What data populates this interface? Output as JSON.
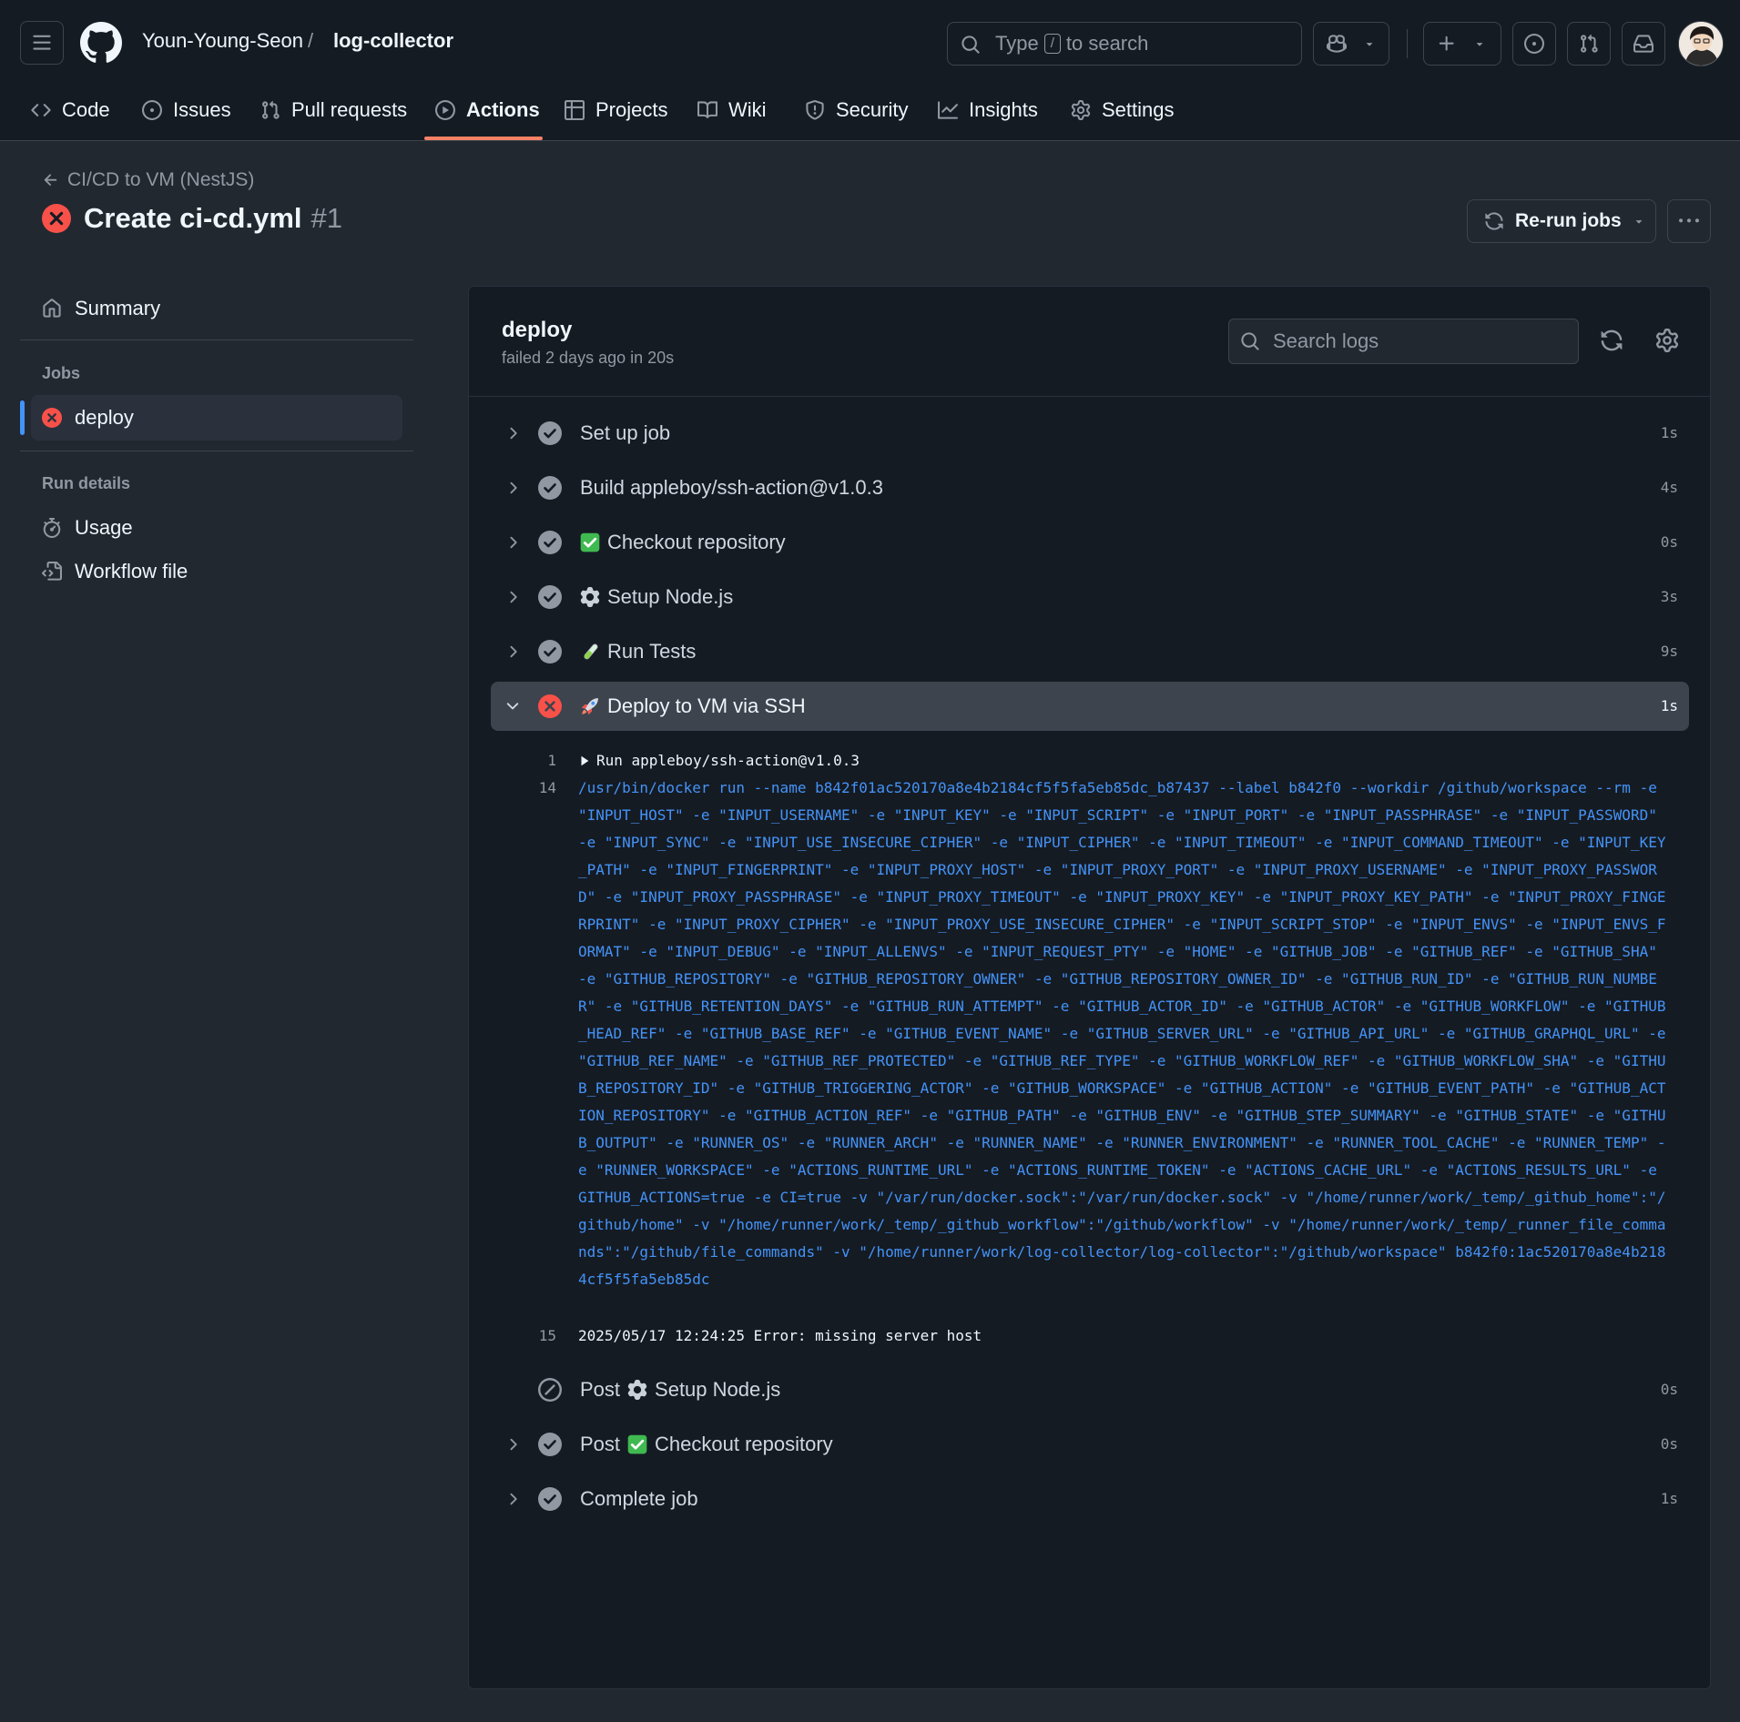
{
  "header": {
    "owner": "Youn-Young-Seon",
    "separator": "/",
    "repo": "log-collector",
    "search_prefix": "Type",
    "search_key": "/",
    "search_suffix": "to search"
  },
  "tabs": [
    {
      "label": "Code",
      "icon": "code-icon"
    },
    {
      "label": "Issues",
      "icon": "issue-icon"
    },
    {
      "label": "Pull requests",
      "icon": "pull-request-icon"
    },
    {
      "label": "Actions",
      "icon": "play-icon",
      "active": true
    },
    {
      "label": "Projects",
      "icon": "table-icon"
    },
    {
      "label": "Wiki",
      "icon": "book-icon"
    },
    {
      "label": "Security",
      "icon": "shield-icon"
    },
    {
      "label": "Insights",
      "icon": "graph-icon"
    },
    {
      "label": "Settings",
      "icon": "gear-icon"
    }
  ],
  "run": {
    "workflow_link": "CI/CD to VM (NestJS)",
    "title": "Create ci-cd.yml",
    "number": "#1",
    "rerun_label": "Re-run jobs"
  },
  "sidebar": {
    "summary": "Summary",
    "jobs_heading": "Jobs",
    "job": "deploy",
    "run_details_heading": "Run details",
    "usage": "Usage",
    "workflow_file": "Workflow file"
  },
  "job": {
    "name": "deploy",
    "status": "failed 2 days ago in 20s",
    "search_placeholder": "Search logs"
  },
  "steps": [
    {
      "prefix": "",
      "emoji": "",
      "label": "Set up job",
      "duration": "1s",
      "status": "success"
    },
    {
      "prefix": "",
      "emoji": "",
      "label": "Build appleboy/ssh-action@v1.0.3",
      "duration": "4s",
      "status": "success"
    },
    {
      "prefix": "",
      "emoji": "check-mark-emoji",
      "label": "Checkout repository",
      "duration": "0s",
      "status": "success"
    },
    {
      "prefix": "",
      "emoji": "gear-emoji",
      "label": "Setup Node.js",
      "duration": "3s",
      "status": "success"
    },
    {
      "prefix": "",
      "emoji": "test-tube-emoji",
      "label": "Run Tests",
      "duration": "9s",
      "status": "success"
    },
    {
      "prefix": "",
      "emoji": "rocket-emoji",
      "label": "Deploy to VM via SSH",
      "duration": "1s",
      "status": "failure",
      "expanded": true
    },
    {
      "prefix": "Post",
      "emoji": "gear-emoji",
      "label": "Setup Node.js",
      "duration": "0s",
      "status": "skipped"
    },
    {
      "prefix": "Post",
      "emoji": "check-mark-emoji",
      "label": "Checkout repository",
      "duration": "0s",
      "status": "success"
    },
    {
      "prefix": "",
      "emoji": "",
      "label": "Complete job",
      "duration": "1s",
      "status": "success"
    }
  ],
  "log": {
    "line1_num": "1",
    "line1_text": "Run appleboy/ssh-action@v1.0.3",
    "line14_num": "14",
    "line14_text": "/usr/bin/docker run --name b842f01ac520170a8e4b2184cf5f5fa5eb85dc_b87437 --label b842f0 --workdir /github/workspace --rm -e \"INPUT_HOST\" -e \"INPUT_USERNAME\" -e \"INPUT_KEY\" -e \"INPUT_SCRIPT\" -e \"INPUT_PORT\" -e \"INPUT_PASSPHRASE\" -e \"INPUT_PASSWORD\" -e \"INPUT_SYNC\" -e \"INPUT_USE_INSECURE_CIPHER\" -e \"INPUT_CIPHER\" -e \"INPUT_TIMEOUT\" -e \"INPUT_COMMAND_TIMEOUT\" -e \"INPUT_KEY_PATH\" -e \"INPUT_FINGERPRINT\" -e \"INPUT_PROXY_HOST\" -e \"INPUT_PROXY_PORT\" -e \"INPUT_PROXY_USERNAME\" -e \"INPUT_PROXY_PASSWORD\" -e \"INPUT_PROXY_PASSPHRASE\" -e \"INPUT_PROXY_TIMEOUT\" -e \"INPUT_PROXY_KEY\" -e \"INPUT_PROXY_KEY_PATH\" -e \"INPUT_PROXY_FINGERPRINT\" -e \"INPUT_PROXY_CIPHER\" -e \"INPUT_PROXY_USE_INSECURE_CIPHER\" -e \"INPUT_SCRIPT_STOP\" -e \"INPUT_ENVS\" -e \"INPUT_ENVS_FORMAT\" -e \"INPUT_DEBUG\" -e \"INPUT_ALLENVS\" -e \"INPUT_REQUEST_PTY\" -e \"HOME\" -e \"GITHUB_JOB\" -e \"GITHUB_REF\" -e \"GITHUB_SHA\" -e \"GITHUB_REPOSITORY\" -e \"GITHUB_REPOSITORY_OWNER\" -e \"GITHUB_REPOSITORY_OWNER_ID\" -e \"GITHUB_RUN_ID\" -e \"GITHUB_RUN_NUMBER\" -e \"GITHUB_RETENTION_DAYS\" -e \"GITHUB_RUN_ATTEMPT\" -e \"GITHUB_ACTOR_ID\" -e \"GITHUB_ACTOR\" -e \"GITHUB_WORKFLOW\" -e \"GITHUB_HEAD_REF\" -e \"GITHUB_BASE_REF\" -e \"GITHUB_EVENT_NAME\" -e \"GITHUB_SERVER_URL\" -e \"GITHUB_API_URL\" -e \"GITHUB_GRAPHQL_URL\" -e \"GITHUB_REF_NAME\" -e \"GITHUB_REF_PROTECTED\" -e \"GITHUB_REF_TYPE\" -e \"GITHUB_WORKFLOW_REF\" -e \"GITHUB_WORKFLOW_SHA\" -e \"GITHUB_REPOSITORY_ID\" -e \"GITHUB_TRIGGERING_ACTOR\" -e \"GITHUB_WORKSPACE\" -e \"GITHUB_ACTION\" -e \"GITHUB_EVENT_PATH\" -e \"GITHUB_ACTION_REPOSITORY\" -e \"GITHUB_ACTION_REF\" -e \"GITHUB_PATH\" -e \"GITHUB_ENV\" -e \"GITHUB_STEP_SUMMARY\" -e \"GITHUB_STATE\" -e \"GITHUB_OUTPUT\" -e \"RUNNER_OS\" -e \"RUNNER_ARCH\" -e \"RUNNER_NAME\" -e \"RUNNER_ENVIRONMENT\" -e \"RUNNER_TOOL_CACHE\" -e \"RUNNER_TEMP\" -e \"RUNNER_WORKSPACE\" -e \"ACTIONS_RUNTIME_URL\" -e \"ACTIONS_RUNTIME_TOKEN\" -e \"ACTIONS_CACHE_URL\" -e \"ACTIONS_RESULTS_URL\" -e GITHUB_ACTIONS=true -e CI=true -v \"/var/run/docker.sock\":\"/var/run/docker.sock\" -v \"/home/runner/work/_temp/_github_home\":\"/github/home\" -v \"/home/runner/work/_temp/_github_workflow\":\"/github/workflow\" -v \"/home/runner/work/_temp/_runner_file_commands\":\"/github/file_commands\" -v \"/home/runner/work/log-collector/log-collector\":\"/github/workspace\" b842f0:1ac520170a8e4b2184cf5f5fa5eb85dc",
    "line15_num": "15",
    "line15_text": "2025/05/17 12:24:25 Error: missing server host"
  },
  "colors": {
    "accent_blue": "#4493f8",
    "error_red": "#f85149",
    "tab_underline": "#f78166"
  }
}
